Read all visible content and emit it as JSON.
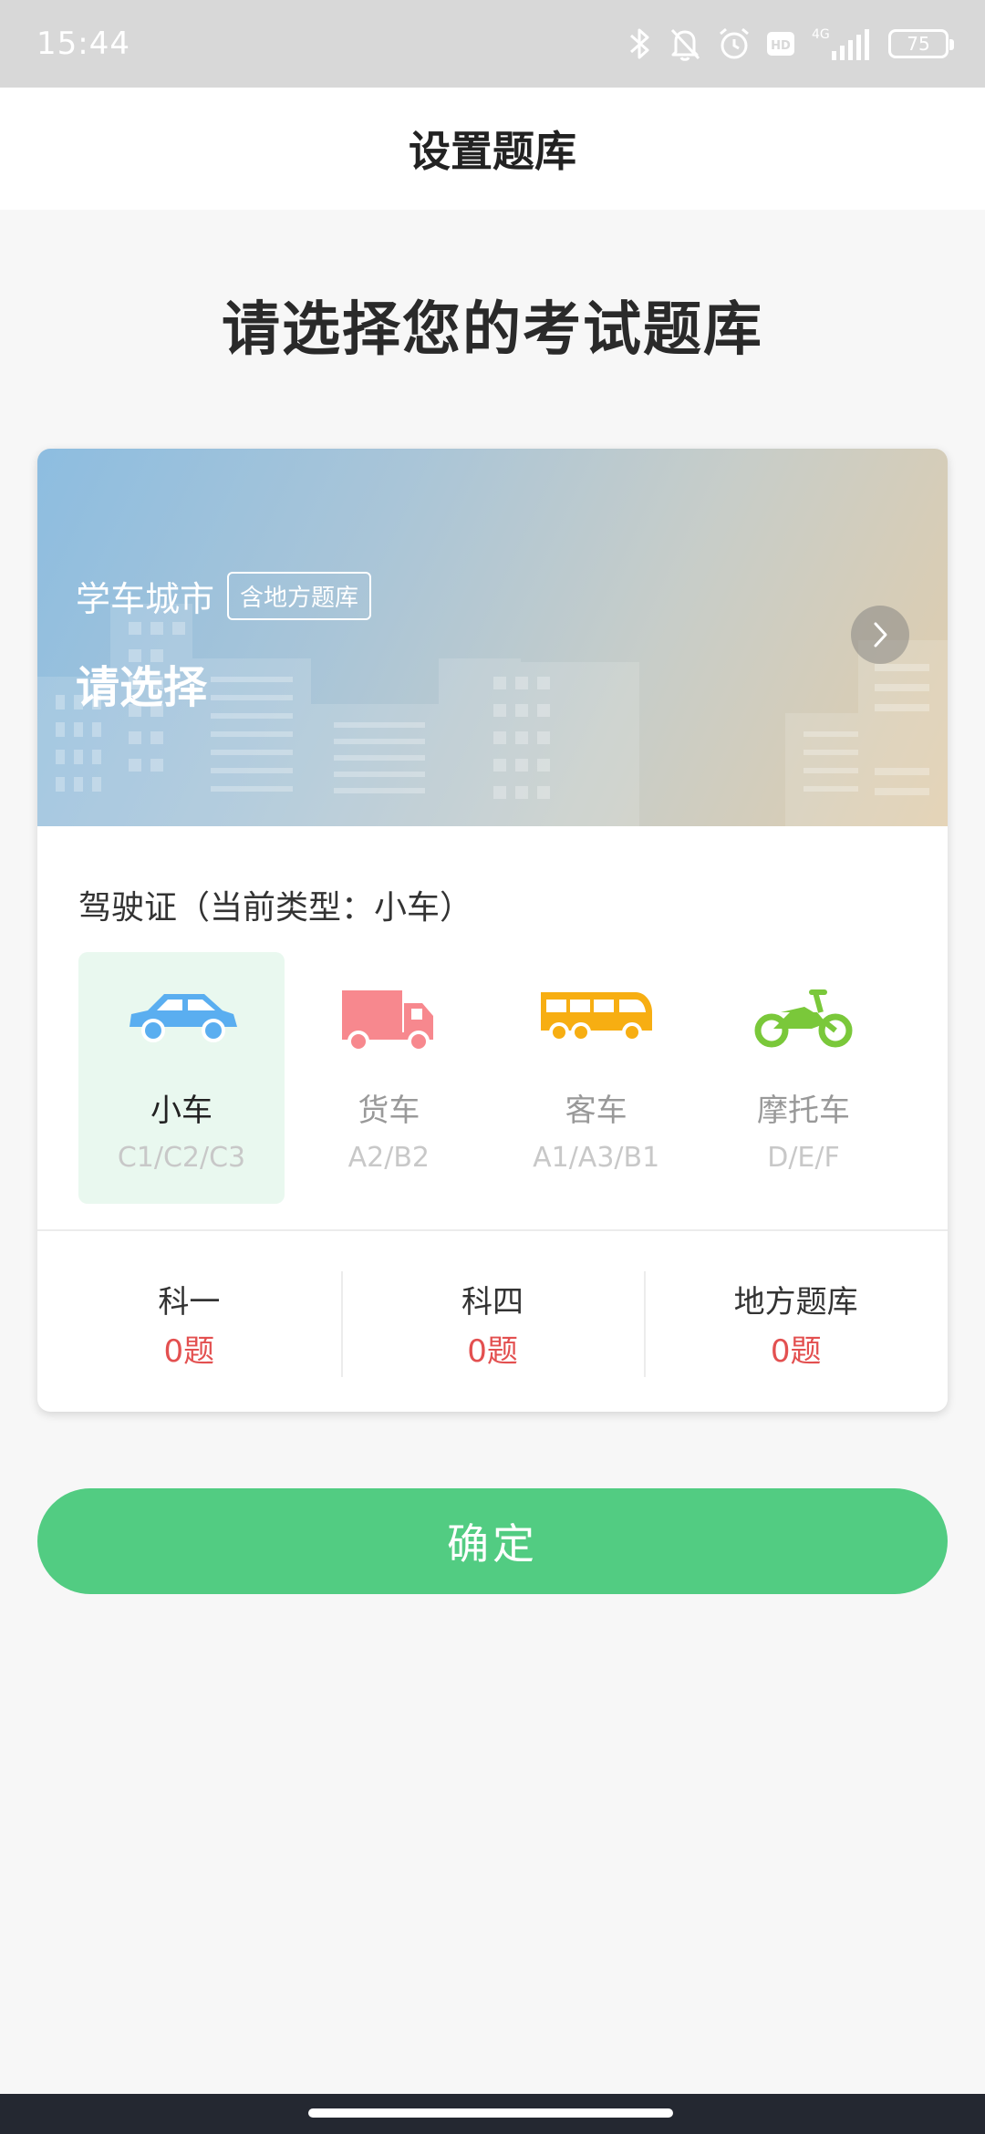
{
  "status_bar": {
    "time": "15:44",
    "network": "4G",
    "battery": "75"
  },
  "header": {
    "title": "设置题库"
  },
  "page": {
    "heading": "请选择您的考试题库"
  },
  "banner": {
    "city_label": "学车城市",
    "badge": "含地方题库",
    "select_prompt": "请选择"
  },
  "license": {
    "title": "驾驶证（当前类型：小车）",
    "vehicles": [
      {
        "name": "小车",
        "codes": "C1/C2/C3",
        "icon": "car-icon",
        "color": "#5aaef0",
        "selected": true
      },
      {
        "name": "货车",
        "codes": "A2/B2",
        "icon": "truck-icon",
        "color": "#f7888e",
        "selected": false
      },
      {
        "name": "客车",
        "codes": "A1/A3/B1",
        "icon": "bus-icon",
        "color": "#f7ae12",
        "selected": false
      },
      {
        "name": "摩托车",
        "codes": "D/E/F",
        "icon": "motorcycle-icon",
        "color": "#7ac83a",
        "selected": false
      }
    ]
  },
  "stats": [
    {
      "label": "科一",
      "count": "0题"
    },
    {
      "label": "科四",
      "count": "0题"
    },
    {
      "label": "地方题库",
      "count": "0题"
    }
  ],
  "confirm_button": {
    "label": "确定"
  },
  "colors": {
    "accent_green": "#52cc82",
    "count_red": "#e35050",
    "selected_bg": "#e9f8ef"
  }
}
